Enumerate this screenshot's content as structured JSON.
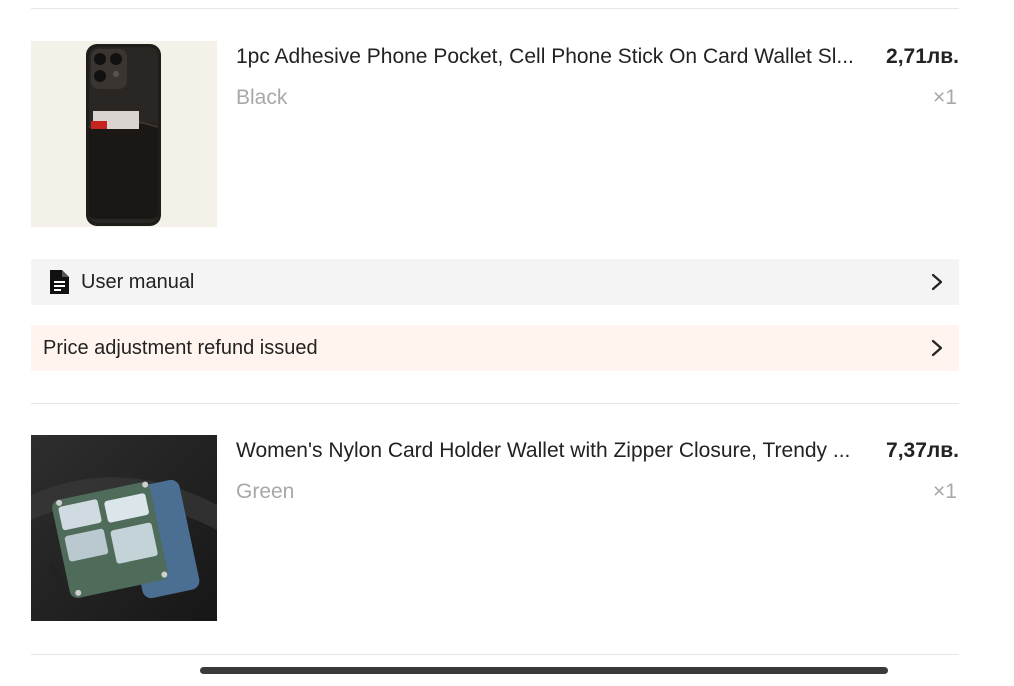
{
  "order_items": [
    {
      "title": "1pc Adhesive Phone Pocket, Cell Phone Stick On Card Wallet Sl...",
      "price": "2,71лв.",
      "variant": "Black",
      "quantity": "×1",
      "image_icon": "black-phone-pocket-image"
    },
    {
      "title": "Women's Nylon Card Holder Wallet with Zipper Closure, Trendy ...",
      "price": "7,37лв.",
      "variant": "Green",
      "quantity": "×1",
      "image_icon": "green-card-wallet-image"
    }
  ],
  "links": {
    "user_manual": "User manual",
    "price_adjustment": "Price adjustment refund issued"
  },
  "icons": {
    "document": "document-icon",
    "chevron": "chevron-right-icon"
  },
  "colors": {
    "manual_row_bg": "#f4f4f4",
    "refund_row_bg": "#fff5ee",
    "muted_text": "#a8a8a8",
    "home_indicator": "#3a3a3a"
  }
}
